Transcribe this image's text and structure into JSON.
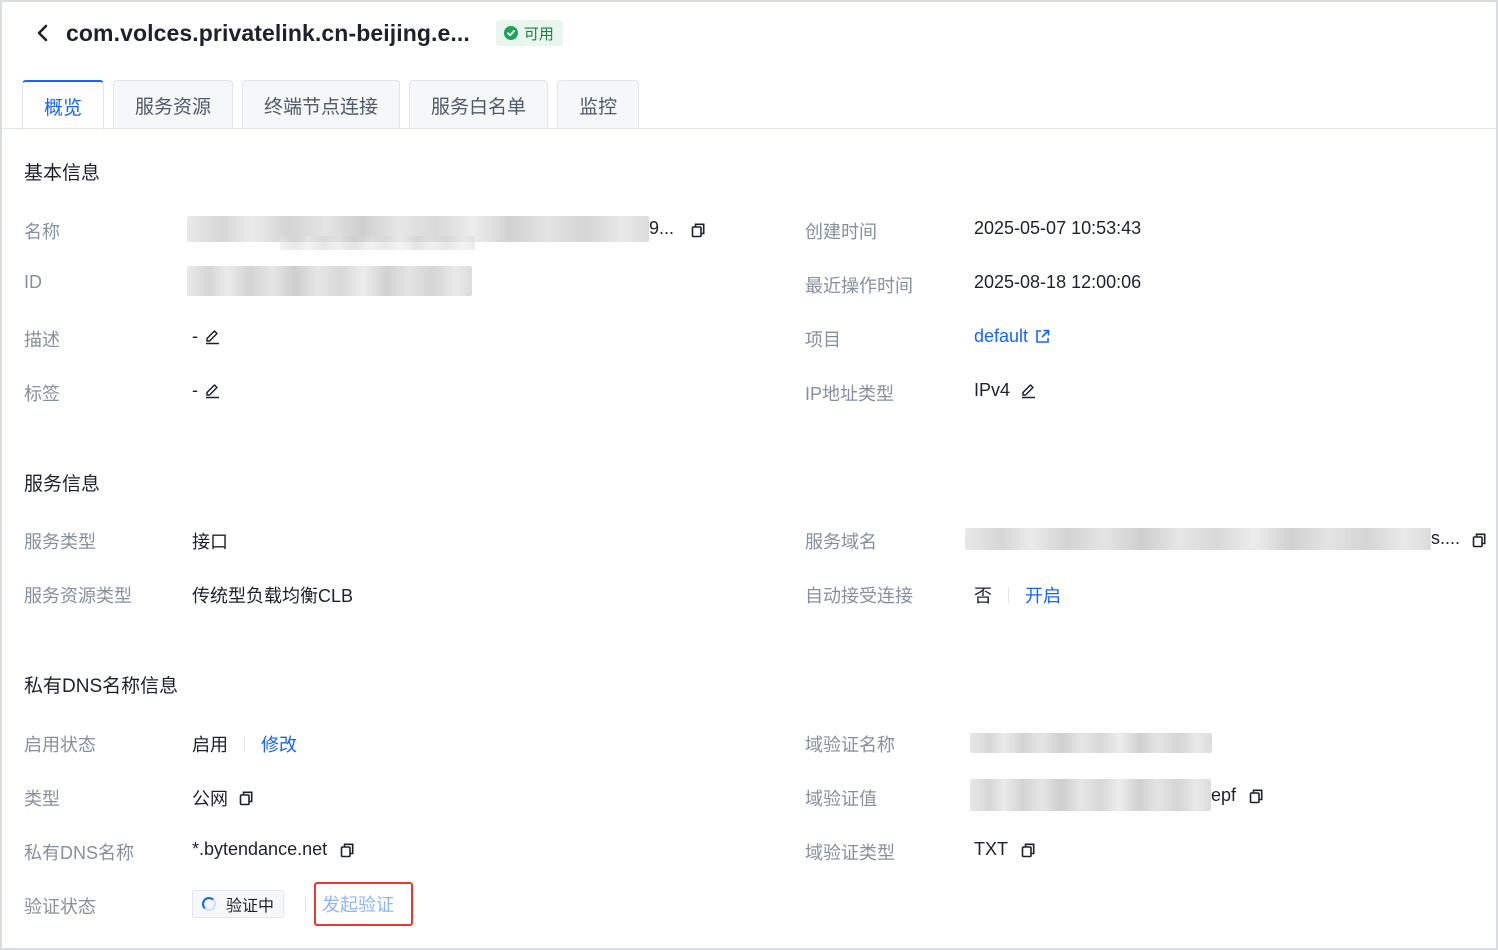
{
  "header": {
    "title": "com.volces.privatelink.cn-beijing.e...",
    "status": "可用"
  },
  "tabs": [
    {
      "label": "概览"
    },
    {
      "label": "服务资源"
    },
    {
      "label": "终端节点连接"
    },
    {
      "label": "服务白名单"
    },
    {
      "label": "监控"
    }
  ],
  "basic": {
    "section_title": "基本信息",
    "name_label": "名称",
    "name_suffix": "9...",
    "id_label": "ID",
    "desc_label": "描述",
    "desc_value": "-",
    "tags_label": "标签",
    "tags_value": "-",
    "created_label": "创建时间",
    "created_value": "2025-05-07 10:53:43",
    "updated_label": "最近操作时间",
    "updated_value": "2025-08-18 12:00:06",
    "project_label": "项目",
    "project_value": "default",
    "ip_type_label": "IP地址类型",
    "ip_type_value": "IPv4"
  },
  "service": {
    "section_title": "服务信息",
    "type_label": "服务类型",
    "type_value": "接口",
    "resource_type_label": "服务资源类型",
    "resource_type_value": "传统型负载均衡CLB",
    "domain_label": "服务域名",
    "domain_suffix": "s....",
    "auto_accept_label": "自动接受连接",
    "auto_accept_value": "否",
    "auto_accept_action": "开启"
  },
  "dns": {
    "section_title": "私有DNS名称信息",
    "enabled_label": "启用状态",
    "enabled_value": "启用",
    "enabled_action": "修改",
    "type_label": "类型",
    "type_value": "公网",
    "name_label": "私有DNS名称",
    "name_value": "*.bytendance.net",
    "verify_status_label": "验证状态",
    "verify_status_value": "验证中",
    "verify_action": "发起验证",
    "domain_verify_name_label": "域验证名称",
    "domain_verify_value_label": "域验证值",
    "domain_verify_value_suffix": "epf",
    "domain_verify_type_label": "域验证类型",
    "domain_verify_type_value": "TXT"
  },
  "colors": {
    "primary": "#1664ff",
    "label": "#86909c",
    "success": "#1ea35b",
    "highlight_border": "#e53935"
  }
}
